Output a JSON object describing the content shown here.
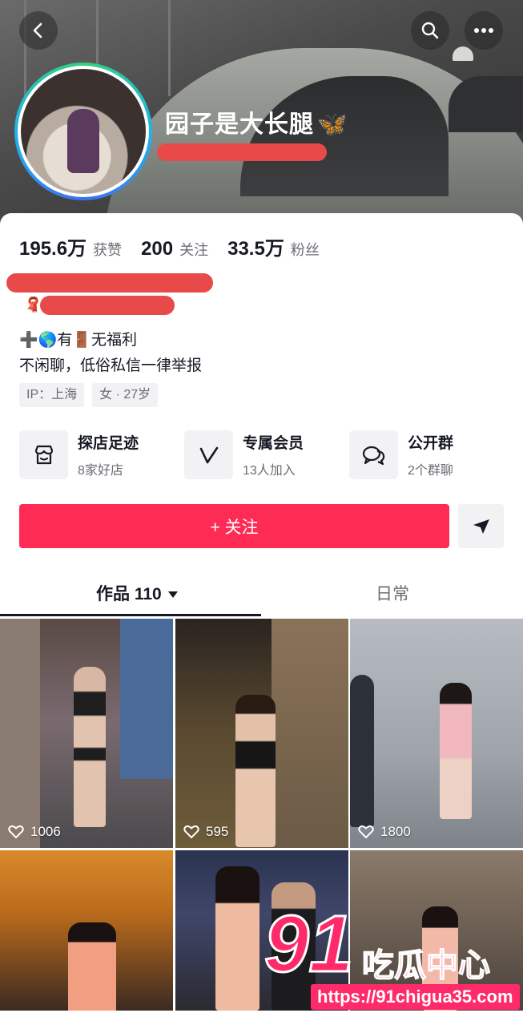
{
  "header": {
    "back_icon": "chevron-left-icon",
    "search_icon": "search-icon",
    "more_icon": "more-icon"
  },
  "profile": {
    "nickname": "园子是大长腿",
    "nickname_emoji": "🦋"
  },
  "stats": [
    {
      "value": "195.6万",
      "label": "获赞"
    },
    {
      "value": "200",
      "label": "关注"
    },
    {
      "value": "33.5万",
      "label": "粉丝"
    }
  ],
  "bio": {
    "line3": "➕🌎有🚪无福利",
    "line4": "不闲聊，低俗私信一律举报"
  },
  "tags": [
    "IP：上海",
    "女 · 27岁"
  ],
  "features": [
    {
      "title": "探店足迹",
      "subtitle": "8家好店",
      "icon": "store-icon"
    },
    {
      "title": "专属会员",
      "subtitle": "13人加入",
      "icon": "v-member-icon"
    },
    {
      "title": "公开群",
      "subtitle": "2个群聊",
      "icon": "chat-group-icon"
    }
  ],
  "actions": {
    "follow_label": "+ 关注",
    "share_icon": "send-icon"
  },
  "tabs": {
    "works_label": "作品 110",
    "daily_label": "日常"
  },
  "videos": [
    {
      "likes": "1006"
    },
    {
      "likes": "595"
    },
    {
      "likes": "1800"
    },
    {
      "likes": ""
    },
    {
      "likes": ""
    },
    {
      "likes": ""
    }
  ],
  "watermark": {
    "number": "91",
    "text": "吃瓜中心",
    "url": "https://91chigua35.com"
  },
  "colors": {
    "accent": "#fe2c55",
    "redaction": "#e84a4a",
    "watermark": "#ff2a6a"
  }
}
